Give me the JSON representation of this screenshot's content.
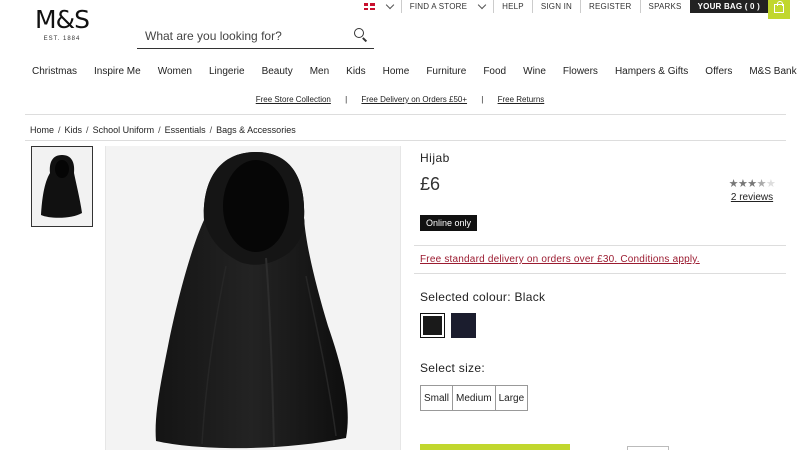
{
  "topbar": {
    "find_store": "FIND A STORE",
    "help": "HELP",
    "sign_in": "SIGN IN",
    "register": "REGISTER",
    "sparks": "SPARKS",
    "bag_label": "YOUR BAG",
    "bag_count": "( 0 )"
  },
  "logo": {
    "text": "M&S",
    "est": "EST. 1884"
  },
  "search": {
    "placeholder": "What are you looking for?"
  },
  "nav": [
    "Christmas",
    "Inspire Me",
    "Women",
    "Lingerie",
    "Beauty",
    "Men",
    "Kids",
    "Home",
    "Furniture",
    "Food",
    "Wine",
    "Flowers",
    "Hampers & Gifts",
    "Offers",
    "M&S Bank"
  ],
  "promo": {
    "store": "Free Store Collection",
    "delivery": "Free Delivery on Orders £50+",
    "returns": "Free Returns",
    "sep": "|"
  },
  "breadcrumb": [
    "Home",
    "Kids",
    "School Uniform",
    "Essentials",
    "Bags & Accessories"
  ],
  "breadcrumb_sep": "/",
  "product": {
    "title": "Hijab",
    "price": "£6",
    "rating": 3.5,
    "rating_max": 5,
    "reviews": "2 reviews",
    "badge": "Online only",
    "delivery_msg": "Free standard delivery on orders over £30. Conditions apply.",
    "colour_label": "Selected colour: Black",
    "colours": [
      {
        "name": "Black",
        "hex": "#1a1a1a"
      },
      {
        "name": "Navy",
        "hex": "#1b1d2e"
      }
    ],
    "size_label": "Select size:",
    "sizes": [
      "Small",
      "Medium",
      "Large"
    ]
  },
  "colors": {
    "accent": "#c1d72e",
    "delivery_text": "#9b1b30",
    "dark": "#111111"
  }
}
